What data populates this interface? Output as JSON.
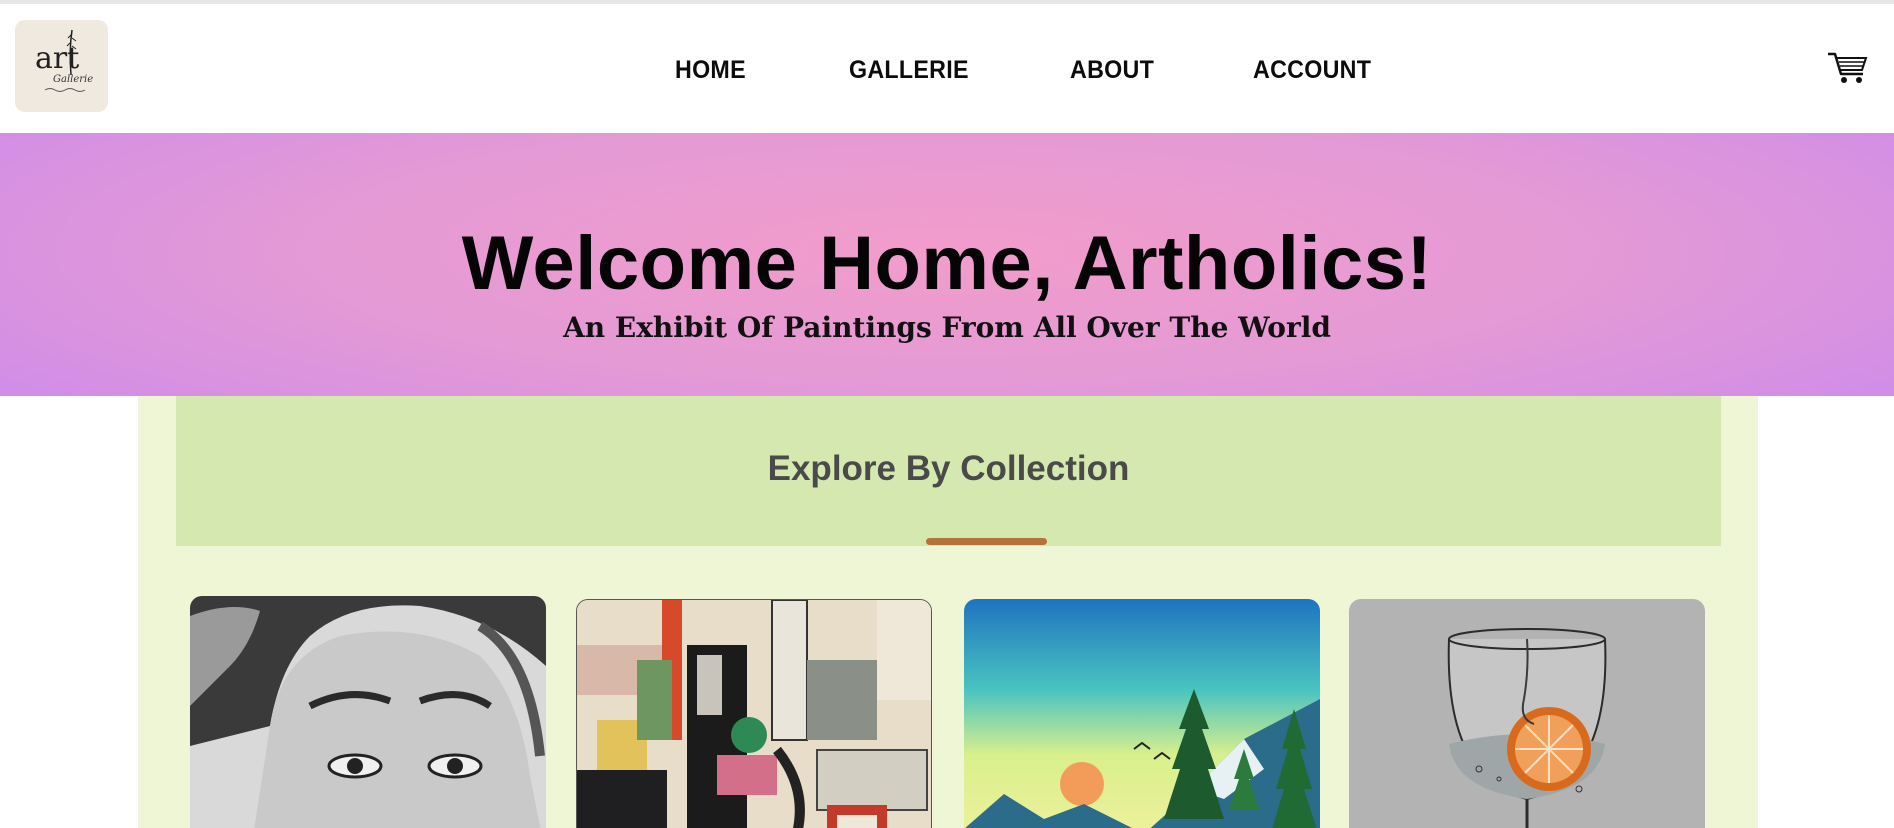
{
  "brand": {
    "logo_line1": "art",
    "logo_line2": "Gallerie"
  },
  "nav": {
    "items": [
      {
        "label": "HOME"
      },
      {
        "label": "GALLERIE"
      },
      {
        "label": "ABOUT"
      },
      {
        "label": "ACCOUNT"
      }
    ],
    "cart_icon": "shopping-cart-icon"
  },
  "hero": {
    "title": "Welcome Home, Artholics!",
    "subtitle": "An Exhibit Of Paintings From All Over The World"
  },
  "collection": {
    "title": "Explore By Collection",
    "cards": [
      {
        "name": "portrait-sketch"
      },
      {
        "name": "cubist-abstract"
      },
      {
        "name": "landscape-sunset"
      },
      {
        "name": "glass-orange-sketch"
      }
    ]
  },
  "colors": {
    "hero_pink": "#f29ccb",
    "hero_purple": "#d28ee6",
    "collection_bg": "#eef6d6",
    "collection_head_bg": "#d4e8b0",
    "divider": "#b4733a"
  }
}
